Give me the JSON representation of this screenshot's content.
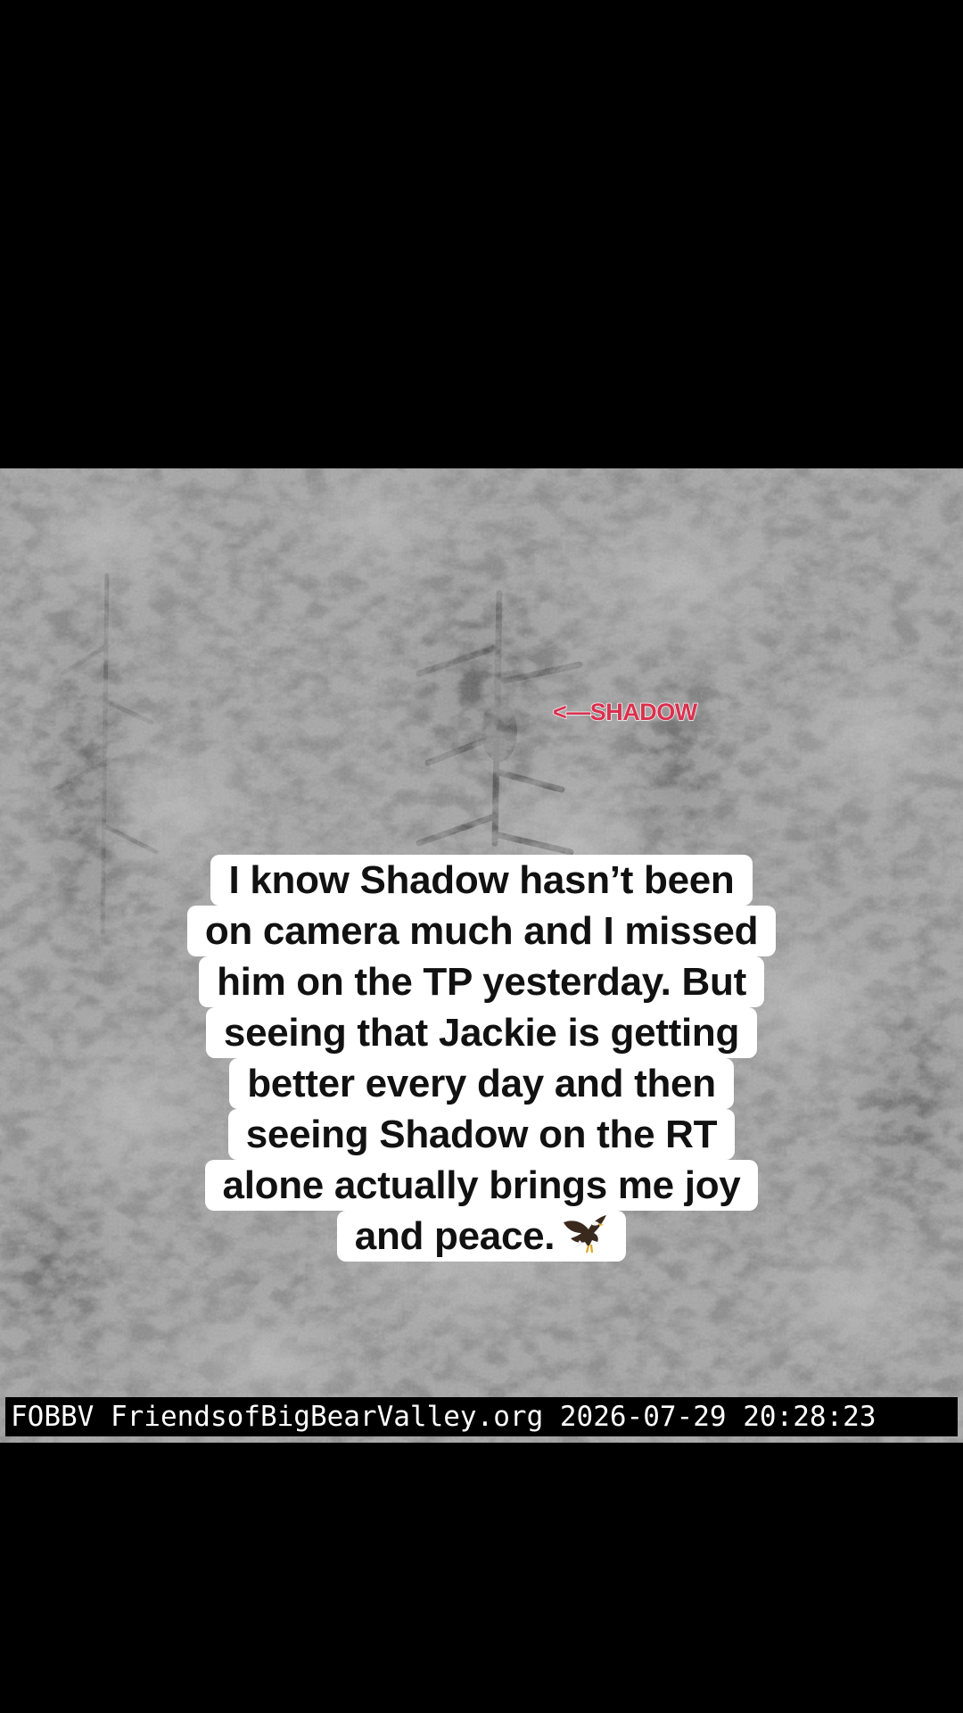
{
  "overlay": {
    "annotation": "<—SHADOW",
    "annotation_color": "#d9314f",
    "caption_lines": [
      "I know Shadow hasn’t been",
      "on camera much and I missed",
      "him on the TP yesterday. But",
      "seeing that Jackie is getting",
      "better every day and then",
      "seeing Shadow on the RT",
      "alone actually brings me joy",
      "and peace."
    ],
    "caption_icon": "eagle-icon"
  },
  "camera": {
    "timestamp_bar": "FOBBV FriendsofBigBearValley.org 2026-07-29 20:28:23"
  }
}
